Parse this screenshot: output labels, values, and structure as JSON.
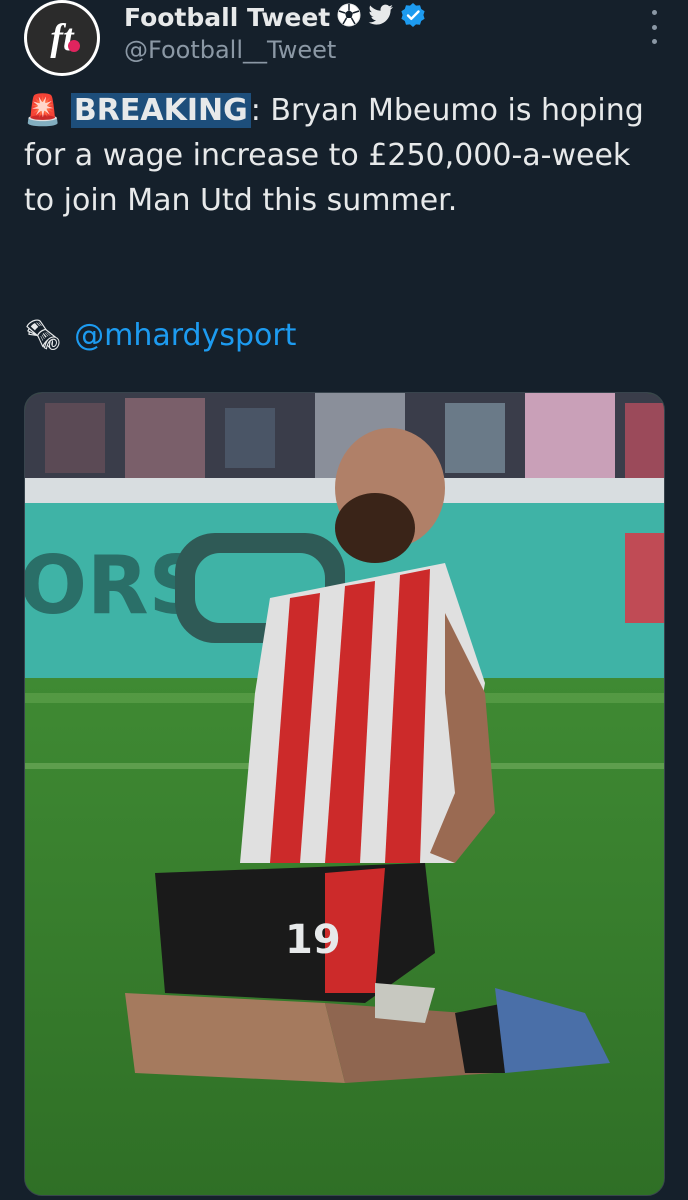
{
  "author": {
    "display_name": "Football Tweet",
    "handle": "@Football__Tweet",
    "avatar_text": "ft",
    "badges": [
      "soccer-ball-icon",
      "bird-icon",
      "verified-badge-icon"
    ]
  },
  "tweet": {
    "siren_emoji": "🚨",
    "highlight": "BREAKING",
    "text_rest": ": Bryan Mbeumo is hoping for a wage increase to £250,000-a-week to join Man Utd this summer.",
    "source_emoji": "🗞",
    "mention": "@mhardysport"
  },
  "media": {
    "alt_subject": "footballer-kneeling-celebration-photo",
    "board_text": "ORS",
    "shirt_number": "19"
  },
  "colors": {
    "background": "#15202b",
    "text": "#e7e9ea",
    "secondary": "#8b98a5",
    "link": "#1d9bf0",
    "verified": "#1d9bf0",
    "highlight": "#1d4e7b"
  }
}
